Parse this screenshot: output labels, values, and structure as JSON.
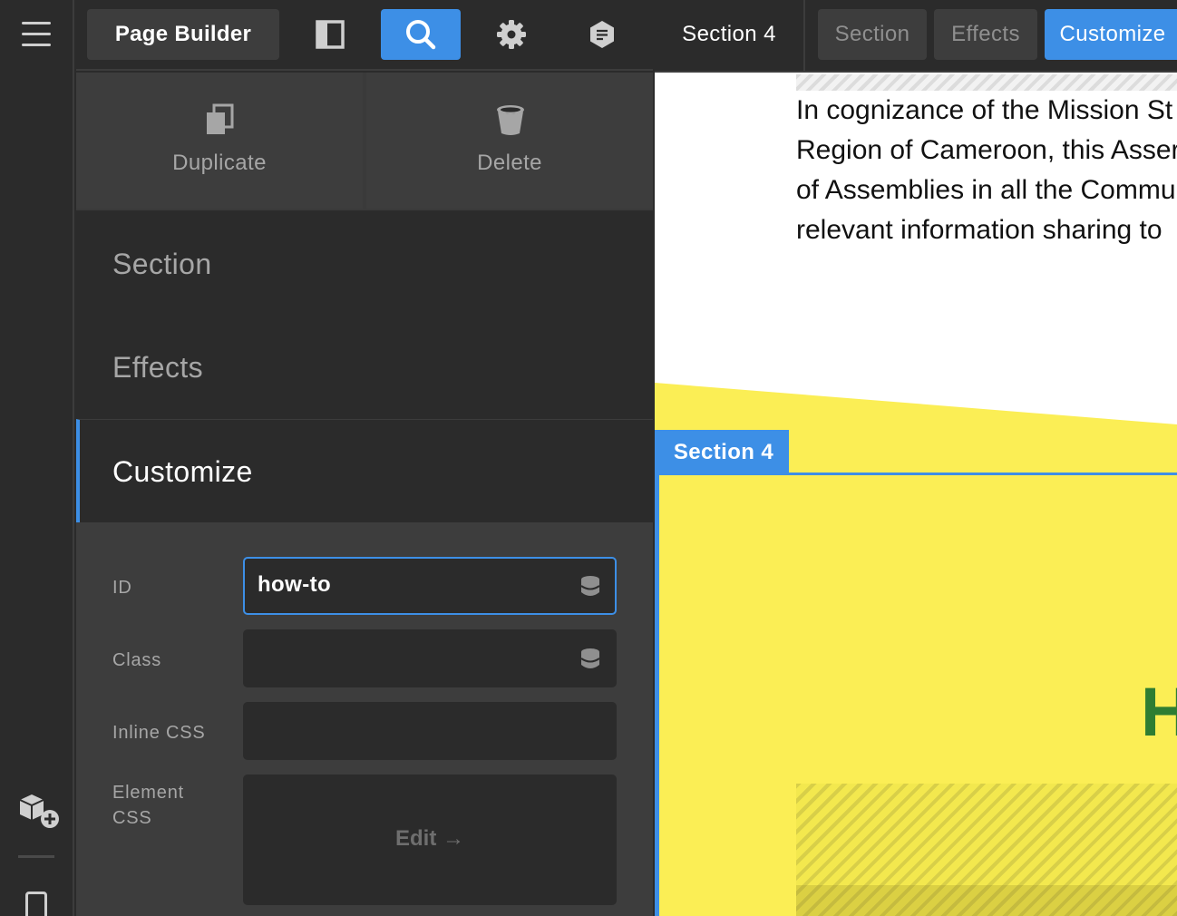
{
  "app": {
    "title": "Page Builder"
  },
  "toolbar": {
    "icons": [
      "layout-panel-icon",
      "search-icon",
      "settings-gear-icon",
      "notes-icon"
    ],
    "active_icon": "search-icon"
  },
  "breadcrumb": {
    "current": "Section 4"
  },
  "right_tabs": [
    {
      "label": "Section",
      "active": false
    },
    {
      "label": "Effects",
      "active": false
    },
    {
      "label": "Customize",
      "active": true
    }
  ],
  "actions": {
    "duplicate": "Duplicate",
    "delete": "Delete"
  },
  "menu": {
    "section": "Section",
    "effects": "Effects",
    "customize": "Customize",
    "active": "Customize"
  },
  "form": {
    "id_label": "ID",
    "id_value": "how-to",
    "class_label": "Class",
    "class_value": "",
    "inline_css_label": "Inline CSS",
    "inline_css_value": "",
    "element_css_label_line1": "Element",
    "element_css_label_line2": "CSS",
    "edit_label": "Edit →"
  },
  "canvas": {
    "paragraph_lines": [
      "In cognizance of the Mission St",
      "Region of Cameroon, this Asser",
      "of Assemblies in all the Commu",
      "relevant information sharing to"
    ],
    "section_label": "Section 4",
    "heading_fragment": "H"
  },
  "colors": {
    "accent": "#3d8fe6",
    "panel_bg": "#2b2b2b",
    "panel_light": "#3d3d3d",
    "section_yellow": "#fbee55",
    "heading_green": "#2e7d32"
  }
}
